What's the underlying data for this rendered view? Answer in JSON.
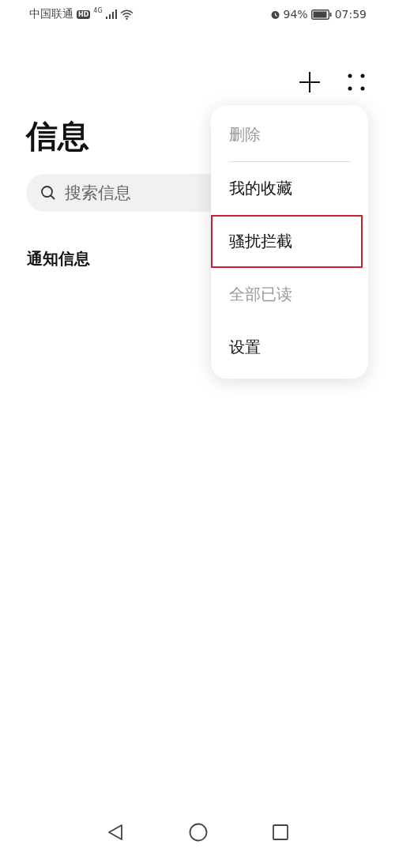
{
  "status_bar": {
    "carrier": "中国联通",
    "hd": "HD",
    "network": "4G",
    "battery": "94%",
    "time": "07:59"
  },
  "title": "信息",
  "search": {
    "placeholder": "搜索信息"
  },
  "section": "通知信息",
  "menu": {
    "items": [
      {
        "label": "删除",
        "disabled": true,
        "highlighted": false,
        "divider": true
      },
      {
        "label": "我的收藏",
        "disabled": false,
        "highlighted": false,
        "divider": false
      },
      {
        "label": "骚扰拦截",
        "disabled": false,
        "highlighted": true,
        "divider": false
      },
      {
        "label": "全部已读",
        "disabled": true,
        "highlighted": false,
        "divider": false
      },
      {
        "label": "设置",
        "disabled": false,
        "highlighted": false,
        "divider": false
      }
    ]
  }
}
